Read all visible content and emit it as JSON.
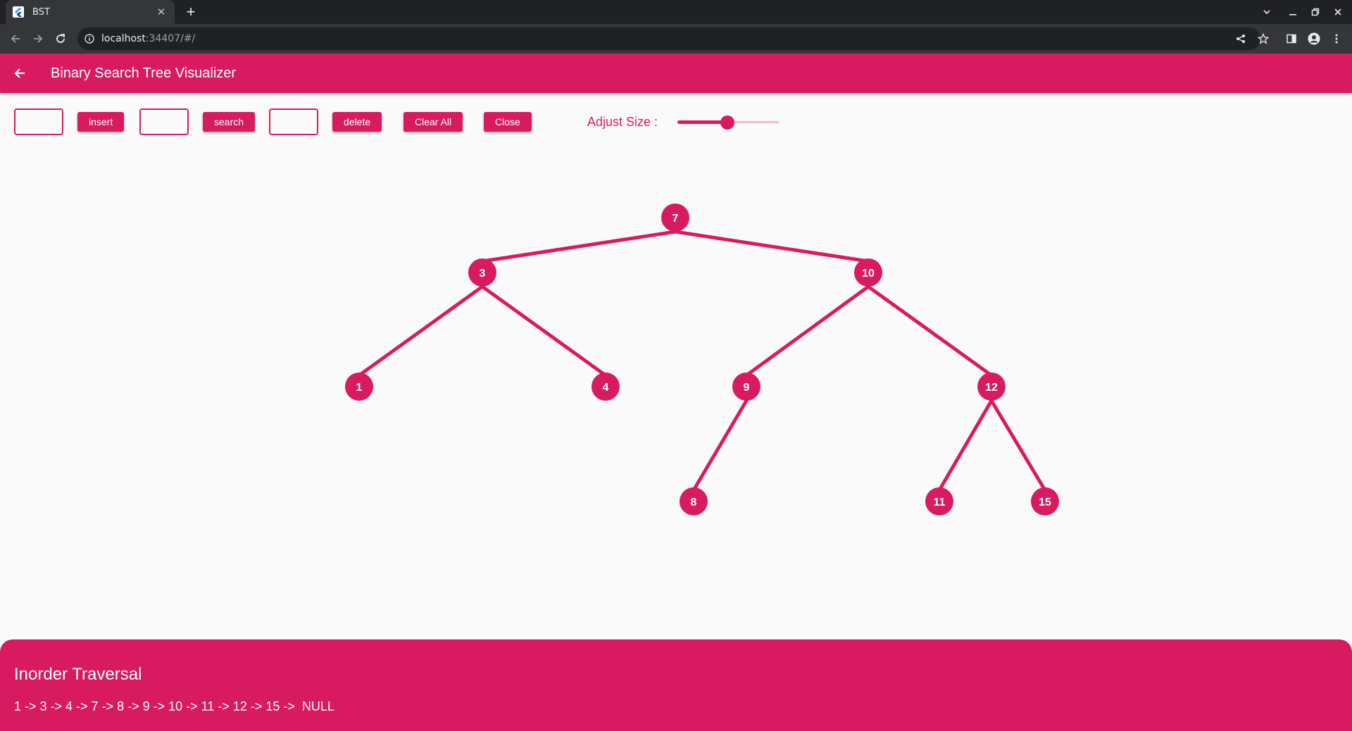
{
  "browser": {
    "tab_title": "BST",
    "url_host": "localhost",
    "url_path": ":34407/#/"
  },
  "appbar": {
    "title": "Binary Search Tree Visualizer"
  },
  "controls": {
    "insert_label": "insert",
    "search_label": "search",
    "delete_label": "delete",
    "clear_label": "Clear All",
    "close_label": "Close",
    "adjust_label": "Adjust Size :",
    "size_fraction": 0.49
  },
  "tree": {
    "nodes": [
      {
        "id": "7",
        "label": "7"
      },
      {
        "id": "3",
        "label": "3"
      },
      {
        "id": "10",
        "label": "10"
      },
      {
        "id": "1",
        "label": "1"
      },
      {
        "id": "4",
        "label": "4"
      },
      {
        "id": "9",
        "label": "9"
      },
      {
        "id": "12",
        "label": "12"
      },
      {
        "id": "8",
        "label": "8"
      },
      {
        "id": "11",
        "label": "11"
      },
      {
        "id": "15",
        "label": "15"
      }
    ],
    "edges": [
      [
        "7",
        "3"
      ],
      [
        "7",
        "10"
      ],
      [
        "3",
        "1"
      ],
      [
        "3",
        "4"
      ],
      [
        "10",
        "9"
      ],
      [
        "10",
        "12"
      ],
      [
        "9",
        "8"
      ],
      [
        "12",
        "11"
      ],
      [
        "12",
        "15"
      ]
    ],
    "colors": {
      "node": "#d81b60",
      "edge": "#d81b60",
      "label": "#ffffff"
    }
  },
  "traversal": {
    "title": "Inorder Traversal",
    "sequence": "1 -> 3 -> 4 -> 7 -> 8 -> 9 -> 10 -> 11 -> 12 -> 15 ->  NULL"
  }
}
